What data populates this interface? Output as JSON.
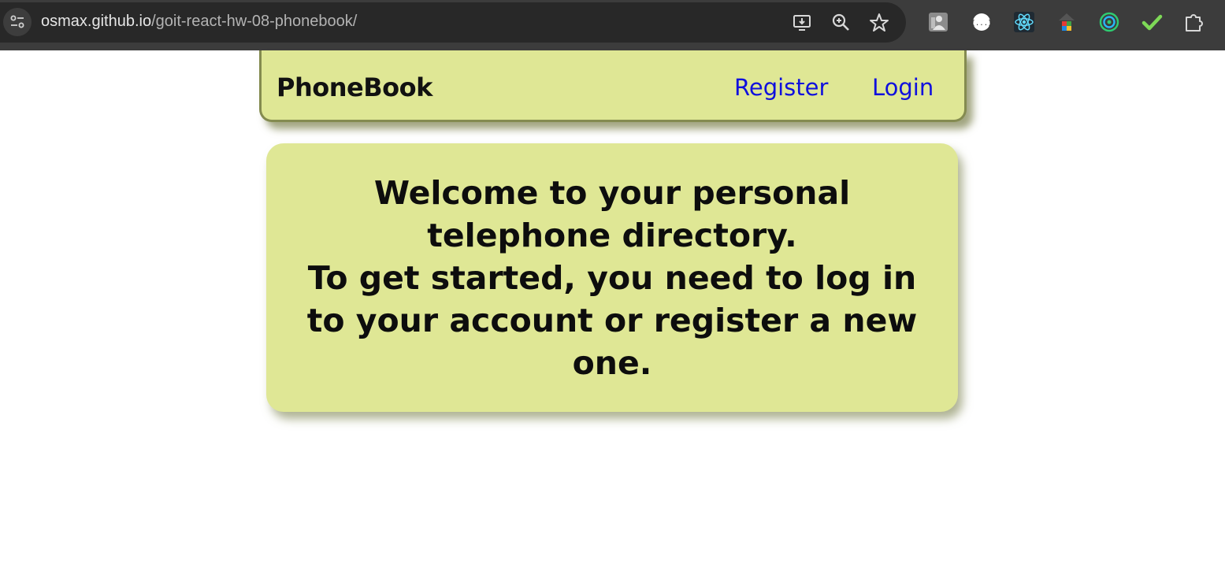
{
  "browser": {
    "url_host": "osmax.github.io",
    "url_path": "/goit-react-hw-08-phonebook/",
    "toolbar_icons": [
      "site-info-icon",
      "install-app-icon",
      "zoom-icon",
      "bookmark-star-icon"
    ],
    "extensions": [
      "profile-extension-icon",
      "json-viewer-extension-icon",
      "react-devtools-icon",
      "color-picker-extension-icon",
      "target-extension-icon",
      "checkmark-extension-icon",
      "extensions-puzzle-icon"
    ]
  },
  "header": {
    "logo": "PhoneBook",
    "nav": {
      "register": "Register",
      "login": "Login"
    }
  },
  "main": {
    "welcome_line1": "Welcome to your personal telephone directory.",
    "welcome_line2": "To get started, you need to log in to your account or register a new one."
  },
  "colors": {
    "panel_bg": "#dfe795",
    "panel_border": "#848b50",
    "link": "#1010dd",
    "text": "#0d0d0d",
    "browser_bar": "#3c3c3c",
    "omnibox": "#282828"
  }
}
